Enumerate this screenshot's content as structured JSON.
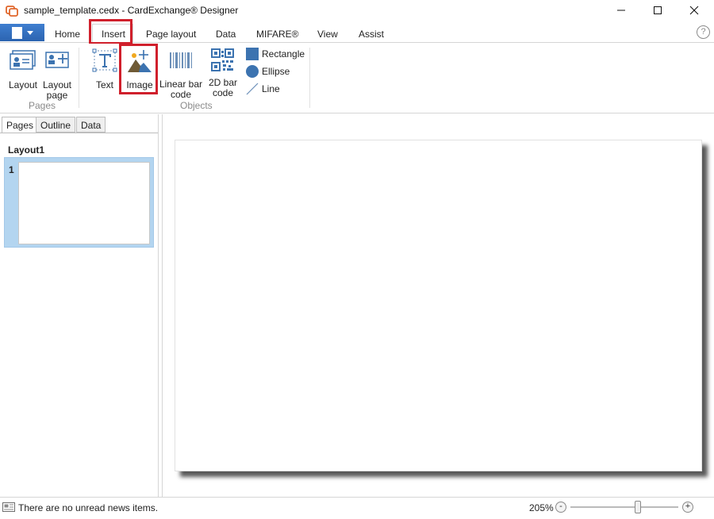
{
  "window": {
    "title": "sample_template.cedx - CardExchange® Designer"
  },
  "tabs": {
    "home": "Home",
    "insert": "Insert",
    "page_layout": "Page layout",
    "data": "Data",
    "mifare": "MIFARE®",
    "view": "View",
    "assist": "Assist"
  },
  "help": {
    "label": "?"
  },
  "ribbon": {
    "pages_group": {
      "label": "Pages",
      "layout": "Layout",
      "layout_page_line1": "Layout",
      "layout_page_line2": "page"
    },
    "objects_group": {
      "label": "Objects",
      "text": "Text",
      "image": "Image",
      "linear_line1": "Linear bar",
      "linear_line2": "code",
      "twod_line1": "2D bar",
      "twod_line2": "code",
      "rectangle": "Rectangle",
      "ellipse": "Ellipse",
      "line": "Line"
    }
  },
  "left_panel": {
    "tabs": [
      "Pages",
      "Outline",
      "Data"
    ],
    "layout_name": "Layout1",
    "page_number": "1"
  },
  "status": {
    "news": "There are no unread news items.",
    "zoom": "205%",
    "zoom_minus": "-",
    "zoom_plus": "+",
    "zoom_fraction": 0.64
  },
  "colors": {
    "highlight": "#d0202c",
    "accent": "#2b63b0",
    "icon_blue": "#3c73b0",
    "selection": "#b3d5f0"
  },
  "icons": [
    "app-icon",
    "minimize-icon",
    "maximize-icon",
    "close-icon",
    "help-icon",
    "news-icon"
  ]
}
